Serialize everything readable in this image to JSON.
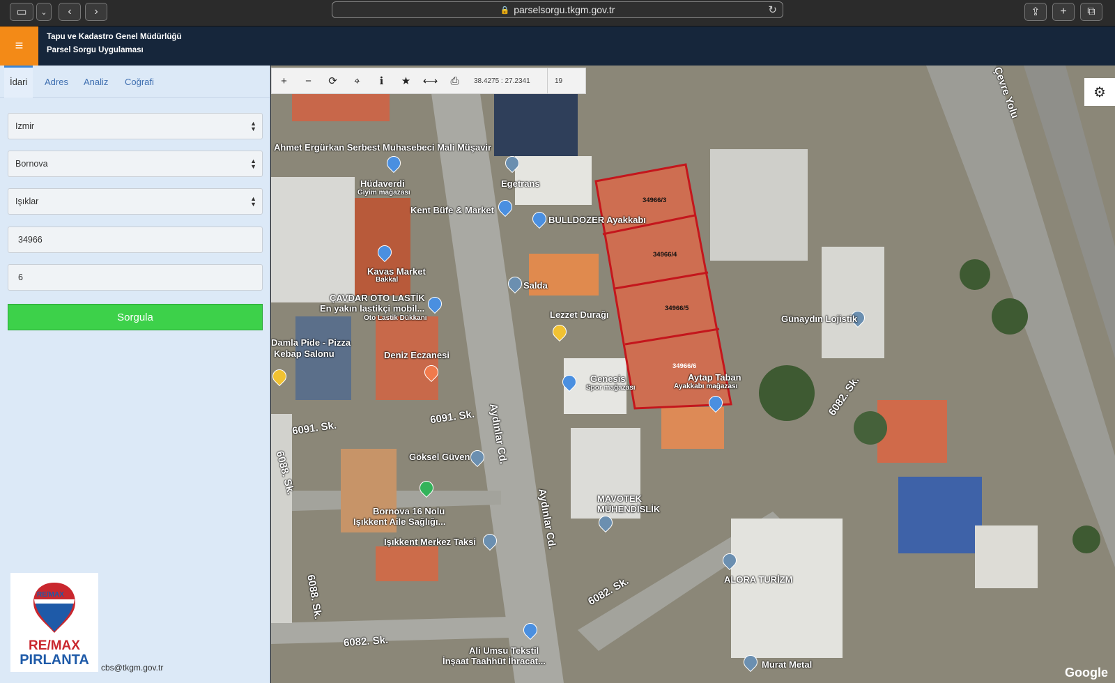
{
  "browser": {
    "url": "parselsorgu.tkgm.gov.tr"
  },
  "header": {
    "line1": "Tapu ve Kadastro Genel Müdürlüğü",
    "line2": "Parsel Sorgu Uygulaması",
    "menu_icon": "≡"
  },
  "tabs": [
    "İdari",
    "Adres",
    "Analiz",
    "Coğrafi"
  ],
  "form": {
    "il": "Izmir",
    "ilce": "Bornova",
    "mahalle": "Işıklar",
    "ada": "34966",
    "parsel": "6",
    "query_label": "Sorgula"
  },
  "footer": {
    "email": "cbs@tkgm.gov.tr"
  },
  "logo": {
    "balloon_text": "RE/MAX",
    "word1": "RE/MAX",
    "word2": "PIRLANTA"
  },
  "map": {
    "coordinates": "38.4275 : 27.2341",
    "zoom": "19",
    "attribution": "Google",
    "parcels": [
      "34966/3",
      "34966/4",
      "34966/5",
      "34966/6"
    ],
    "places": [
      "Ahmet Ergürkan Serbest Muhasebeci Mali Müşavir",
      "Hüdaverdi",
      "Giyim mağazası",
      "Kent Büfe & Market",
      "Egetrans",
      "BULLDOZER Ayakkabı",
      "Kavas Market",
      "Bakkal",
      "ÇAVDAR OTO LASTİK",
      "En yakın lastikçi mobil...",
      "Oto Lastik Dükkanı",
      "Salda",
      "Lezzet Durağı",
      "Damla Pide - Pizza",
      "Kebap Salonu",
      "Deniz Eczanesi",
      "Genesis",
      "Spor mağazası",
      "Aytap Taban",
      "Ayakkabı mağazası",
      "Günaydın Lojistik",
      "Göksel Güven",
      "Bornova 16 Nolu",
      "Işıkkent Aile Sağlığı...",
      "Işıkkent Merkez Taksi",
      "MAVOTEK MÜHENDİSLİK",
      "ALORA TURİZM",
      "Ali Umsu Tekstil",
      "İnşaat Taahhüt İhracat...",
      "Murat Metal"
    ],
    "streets": [
      "6091. Sk.",
      "6091. Sk.",
      "6088. Sk.",
      "6088. Sk.",
      "Aydınlar Cd.",
      "Aydınlar Cd.",
      "6082. Sk.",
      "6082. Sk.",
      "6082. Sk.",
      "İzmir Çevre Yolu"
    ]
  },
  "colors": {
    "header_bg": "#16263b",
    "menu_orange": "#f38a17",
    "query_green": "#3dd14a",
    "parcel_red": "#c4161c"
  }
}
